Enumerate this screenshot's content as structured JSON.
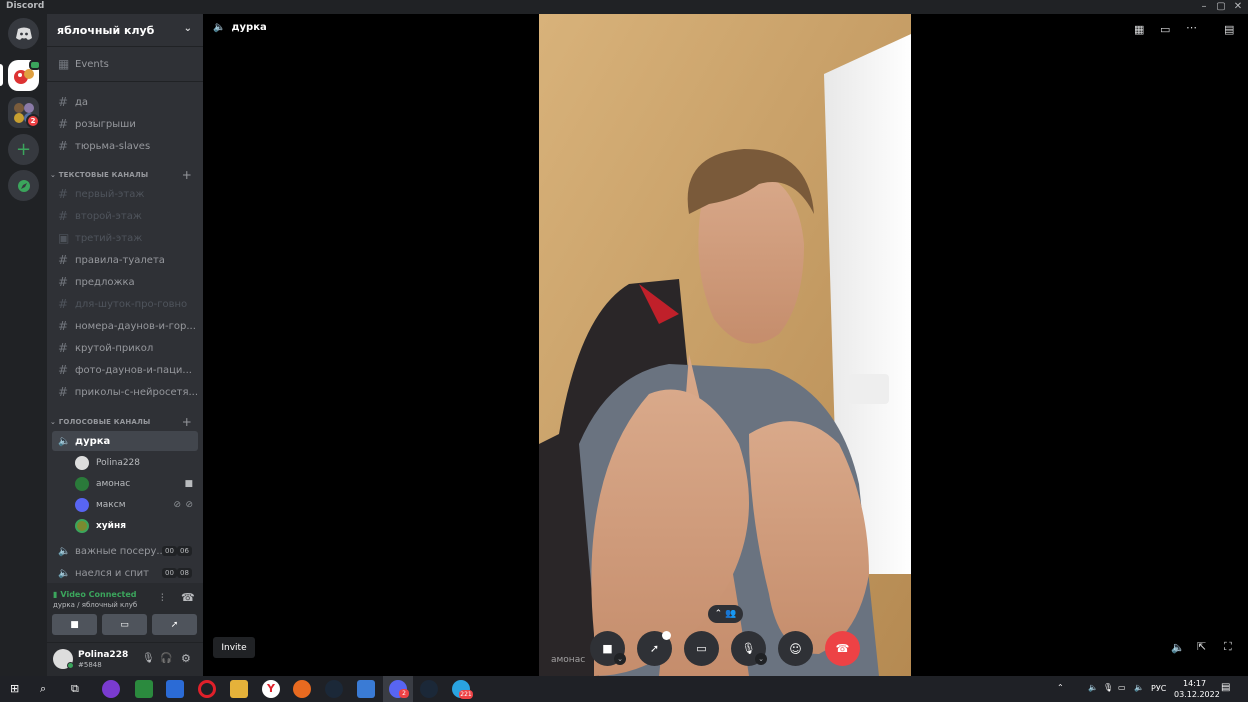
{
  "titlebar": {
    "app": "Discord"
  },
  "server": {
    "name": "яблочный клуб"
  },
  "events": {
    "label": "Events"
  },
  "top_channels": [
    {
      "name": "да"
    },
    {
      "name": "розыгрыши"
    },
    {
      "name": "тюрьма-slaves"
    }
  ],
  "text_category": {
    "label": "ТЕКСТОВЫЕ КАНАЛЫ"
  },
  "text_channels": [
    {
      "name": "первый-этаж"
    },
    {
      "name": "второй-этаж"
    },
    {
      "name": "третий-этаж"
    },
    {
      "name": "правила-туалета"
    },
    {
      "name": "предложка"
    },
    {
      "name": "для-шуток-про-говно"
    },
    {
      "name": "номера-даунов-и-гор..."
    },
    {
      "name": "крутой-прикол"
    },
    {
      "name": "фото-даунов-и-паци..."
    },
    {
      "name": "приколы-с-нейросетя..."
    }
  ],
  "voice_category": {
    "label": "ГОЛОСОВЫЕ КАНАЛЫ"
  },
  "voice_active": {
    "name": "дурка"
  },
  "voice_users": [
    {
      "name": "Polina228"
    },
    {
      "name": "амонас"
    },
    {
      "name": "максм"
    },
    {
      "name": "хуйня"
    }
  ],
  "voice_other": [
    {
      "name": "важные посеру...",
      "b1": "00",
      "b2": "06"
    },
    {
      "name": "наелся и спит",
      "b1": "00",
      "b2": "08"
    }
  ],
  "voice_status": {
    "title": "Video Connected",
    "subtitle": "дурка / яблочный клуб"
  },
  "user": {
    "name": "Polina228",
    "tag": "#5848"
  },
  "main": {
    "channel_title": "дурка",
    "video_label": "амонас",
    "tooltip": "Invite"
  },
  "guild_badges": {
    "g2": "2"
  },
  "taskbar": {
    "lang": "РУС",
    "time": "14:17",
    "date": "03.12.2022",
    "telegram_badge": "221",
    "discord_badge": "2"
  },
  "colors": {
    "accent": "#5865f2",
    "danger": "#ed4245",
    "connected": "#3ba55c"
  }
}
